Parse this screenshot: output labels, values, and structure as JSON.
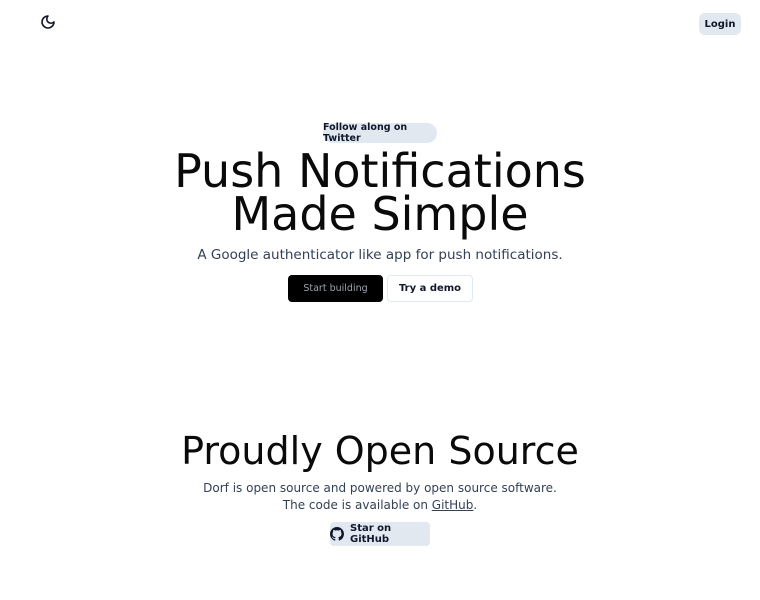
{
  "header": {
    "theme_toggle_icon": "moon-icon",
    "login_label": "Login"
  },
  "hero": {
    "badge_label": "Follow along on Twitter",
    "title_line1": "Push Notifications",
    "title_line2": "Made Simple",
    "subtitle": "A Google authenticator like app for push notifications.",
    "primary_button": "Start building",
    "secondary_button": "Try a demo"
  },
  "open_source": {
    "title": "Proudly Open Source",
    "text_line1": "Dorf is open source and powered by open source software.",
    "text_line2_prefix": "The code is available on ",
    "text_line2_link": "GitHub",
    "text_line2_suffix": ".",
    "button_icon": "github-icon",
    "button_label": "Star on GitHub"
  },
  "colors": {
    "accent_bg": "#e2e8f0",
    "primary_button_bg": "#000000",
    "primary_button_text": "#9ca3af"
  }
}
